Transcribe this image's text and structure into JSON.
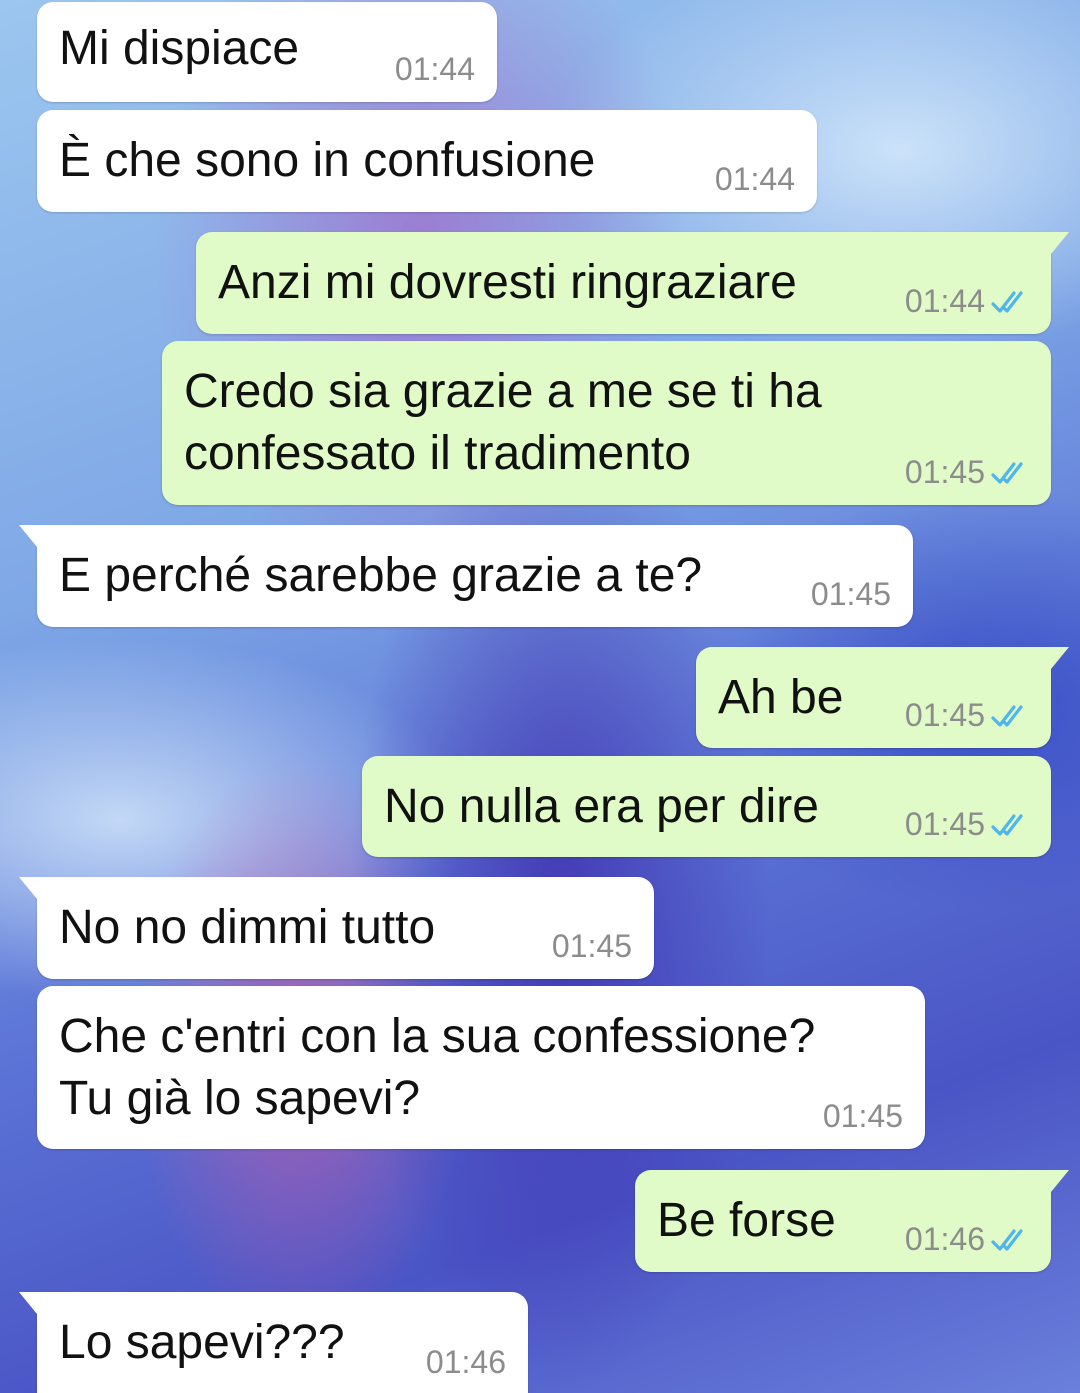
{
  "chat": {
    "messages": [
      {
        "direction": "in",
        "text": "Mi dispiace",
        "time": "01:44"
      },
      {
        "direction": "in",
        "text": "È che sono in confusione",
        "time": "01:44"
      },
      {
        "direction": "out",
        "text": "Anzi mi dovresti ringraziare",
        "time": "01:44",
        "status": "read"
      },
      {
        "direction": "out",
        "text": "Credo sia grazie a me se ti ha\nconfessato il tradimento",
        "time": "01:45",
        "status": "read"
      },
      {
        "direction": "in",
        "text": "E perché sarebbe grazie a te?",
        "time": "01:45"
      },
      {
        "direction": "out",
        "text": "Ah be",
        "time": "01:45",
        "status": "read"
      },
      {
        "direction": "out",
        "text": "No nulla era per dire",
        "time": "01:45",
        "status": "read"
      },
      {
        "direction": "in",
        "text": "No no dimmi tutto",
        "time": "01:45"
      },
      {
        "direction": "in",
        "text": "Che c'entri con la sua confessione?\nTu già lo sapevi?",
        "time": "01:45"
      },
      {
        "direction": "out",
        "text": "Be forse",
        "time": "01:46",
        "status": "read"
      },
      {
        "direction": "in",
        "text": "Lo sapevi???",
        "time": "01:46"
      }
    ]
  },
  "colors": {
    "incoming_bubble": "#ffffff",
    "outgoing_bubble": "#e1fbc8",
    "read_ticks": "#4fb6ec",
    "timestamp": "#8c8c8c"
  },
  "icons": {
    "read_status": "double-check-icon"
  }
}
